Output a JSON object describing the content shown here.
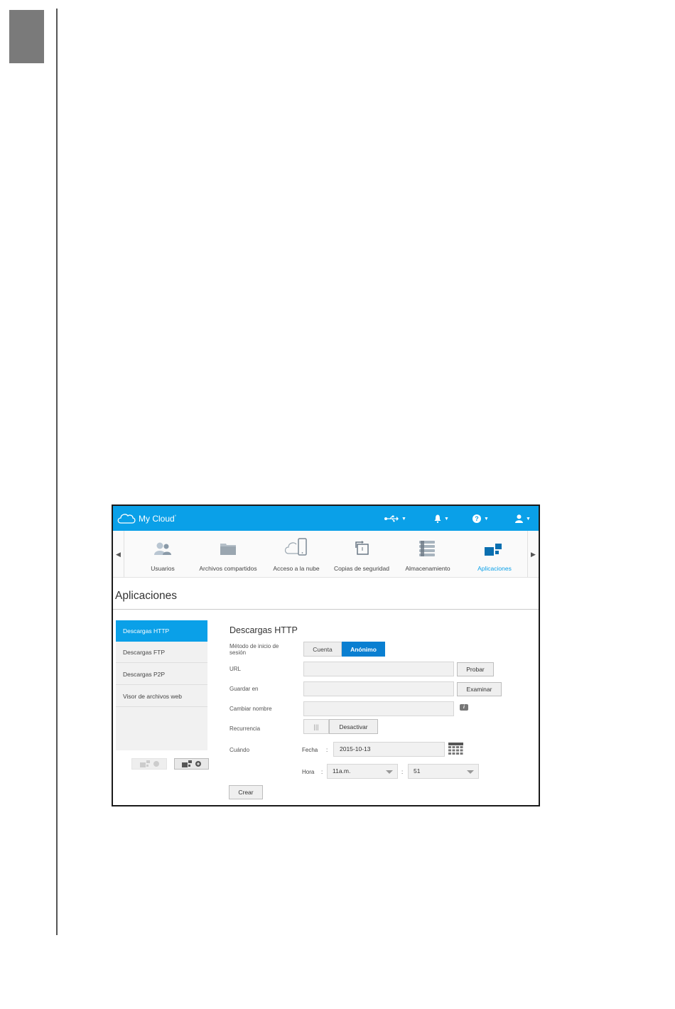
{
  "colors": {
    "brand": "#0aa0e8",
    "selected_segment": "#0a7fd1"
  },
  "app": {
    "brand": "My Cloud",
    "brand_mark": "°",
    "topbar_icons": [
      "usb-icon",
      "bell-icon",
      "help-icon",
      "user-icon"
    ]
  },
  "nav": {
    "items": [
      {
        "label": "Usuarios",
        "icon": "users-icon"
      },
      {
        "label": "Archivos compartidos",
        "icon": "folder-icon"
      },
      {
        "label": "Acceso a la nube",
        "icon": "cloud-device-icon"
      },
      {
        "label": "Copias de seguridad",
        "icon": "backup-icon"
      },
      {
        "label": "Almacenamiento",
        "icon": "storage-icon"
      },
      {
        "label": "Aplicaciones",
        "icon": "apps-icon",
        "active": true
      }
    ]
  },
  "page": {
    "title": "Aplicaciones"
  },
  "sidebar": {
    "items": [
      {
        "label": "Descargas HTTP",
        "active": true
      },
      {
        "label": "Descargas FTP"
      },
      {
        "label": "Descargas P2P"
      },
      {
        "label": "Visor de archivos web"
      }
    ]
  },
  "form": {
    "title": "Descargas HTTP",
    "login_method": {
      "label": "Método de inicio de sesión",
      "options": [
        "Cuenta",
        "Anónimo"
      ],
      "selected": "Anónimo"
    },
    "url": {
      "label": "URL",
      "value": "",
      "button": "Probar"
    },
    "save_to": {
      "label": "Guardar en",
      "value": "",
      "button": "Examinar"
    },
    "rename": {
      "label": "Cambiar nombre",
      "value": "",
      "info": "i"
    },
    "recurrence": {
      "label": "Recurrencia",
      "toggle_glyph": "|||",
      "button": "Desactivar"
    },
    "when": {
      "label": "Cuándo",
      "date_label": "Fecha",
      "date_value": "2015-10-13",
      "time_label": "Hora",
      "hour_value": "11a.m.",
      "minute_value": "51",
      "colon": ":"
    },
    "create_button": "Crear"
  }
}
